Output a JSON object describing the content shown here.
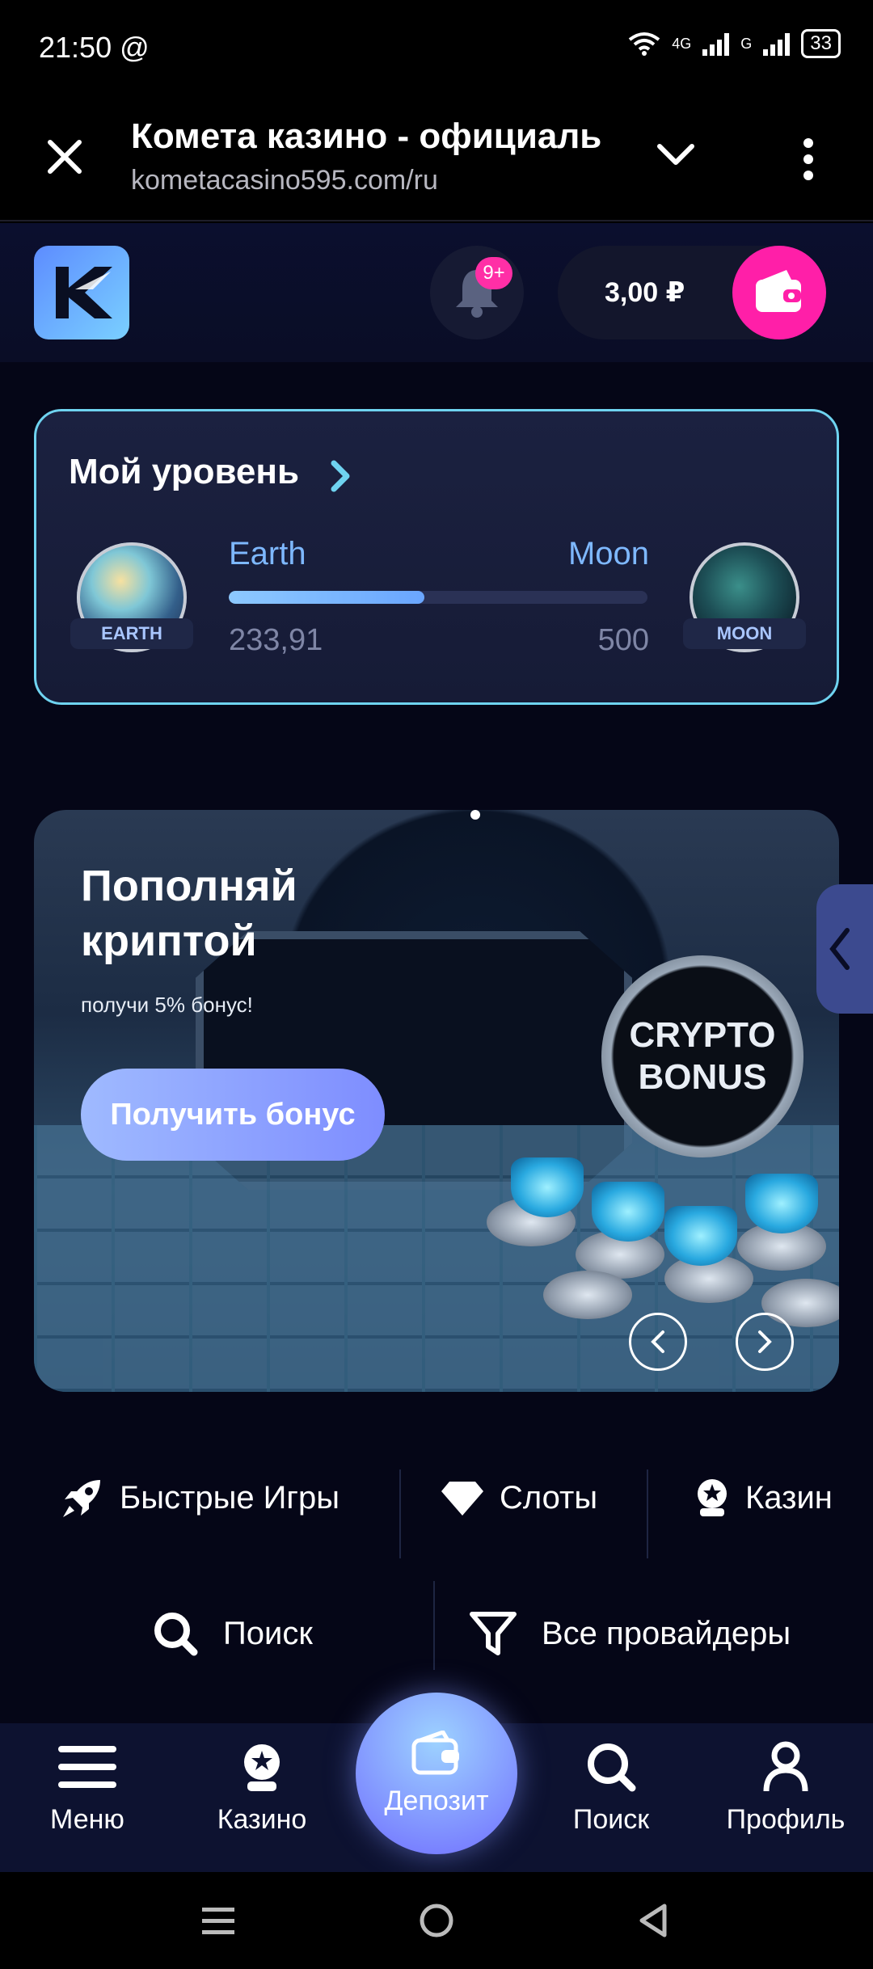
{
  "status_bar": {
    "time": "21:50",
    "at_symbol": "@",
    "network_1": "4G",
    "network_2": "G",
    "battery": "33"
  },
  "browser": {
    "title": "Комета казино - официаль",
    "url": "kometacasino595.com/ru"
  },
  "header": {
    "notifications_badge": "9+",
    "balance": "3,00 ₽"
  },
  "level": {
    "title": "Мой уровень",
    "from_name": "Earth",
    "to_name": "Moon",
    "from_badge": "EARTH",
    "to_badge": "MOON",
    "current": "233,91",
    "target": "500",
    "progress_fraction": 0.4678
  },
  "banner": {
    "title": "Пополняй криптой",
    "subtitle": "получи 5% бонус!",
    "cta": "Получить бонус",
    "coin_text_line1": "CRYPTO",
    "coin_text_line2": "BONUS"
  },
  "categories": [
    {
      "label": "Быстрые Игры",
      "icon": "rocket-icon"
    },
    {
      "label": "Слоты",
      "icon": "diamond-icon"
    },
    {
      "label": "Казин",
      "icon": "casino-icon"
    }
  ],
  "tools": {
    "search": "Поиск",
    "providers": "Все провайдеры"
  },
  "bottom_nav": {
    "menu": "Меню",
    "casino": "Казино",
    "deposit": "Депозит",
    "search": "Поиск",
    "profile": "Профиль"
  },
  "colors": {
    "accent_pink": "#ff1fa8",
    "level_border": "#6fd3f0",
    "nav_bg": "#0d1230"
  }
}
